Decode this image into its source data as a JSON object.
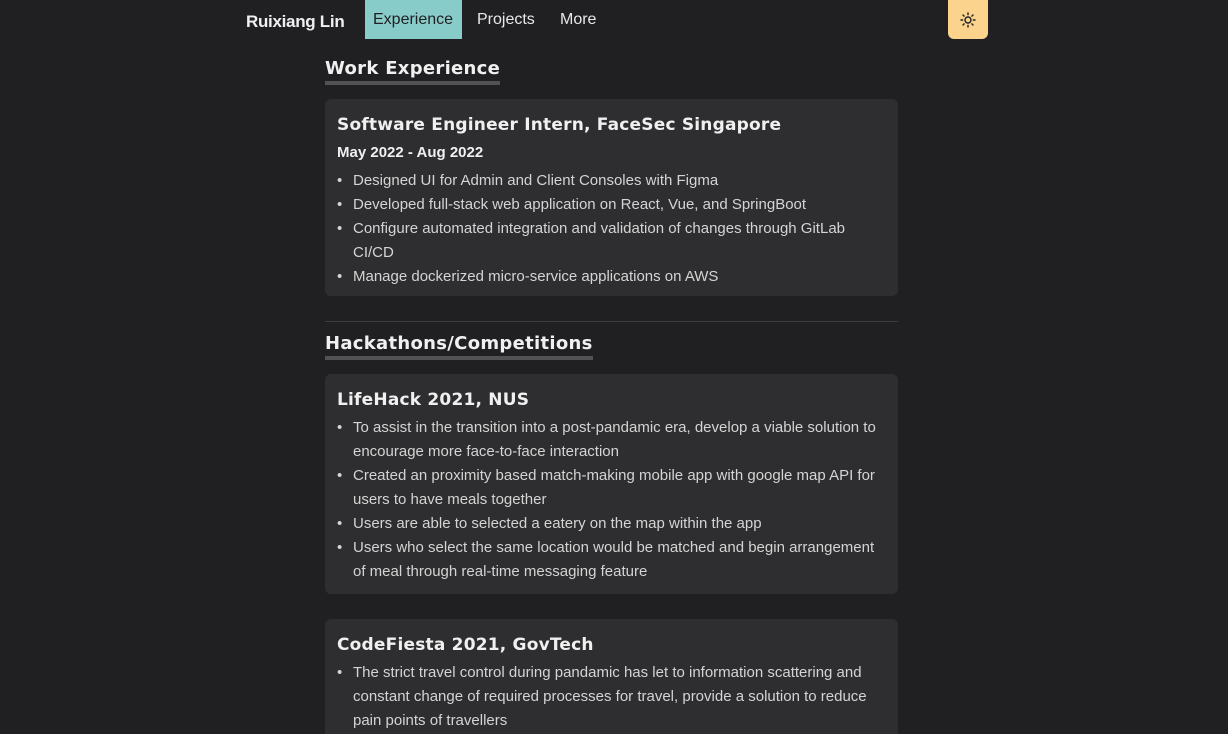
{
  "nav": {
    "logo": "Ruixiang Lin",
    "links": [
      "Experience",
      "Projects",
      "More"
    ],
    "theme_icon": "sun-icon",
    "accent_color": "#88ccca",
    "theme_button_color": "#fbd38d"
  },
  "work": {
    "title": "Work Experience",
    "jobs": [
      {
        "title": "Software Engineer Intern, FaceSec Singapore",
        "date": "May 2022 - Aug 2022",
        "bullets": [
          "Designed UI for Admin and Client Consoles with Figma",
          "Developed full-stack web application on React, Vue, and SpringBoot",
          "Configure automated integration and validation of changes through GitLab CI/CD",
          "Manage dockerized micro-service applications on AWS"
        ]
      }
    ]
  },
  "hackathons": {
    "title": "Hackathons/Competitions",
    "items": [
      {
        "title": "LifeHack 2021, NUS",
        "bullets": [
          "To assist in the transition into a post-pandamic era, develop a viable solution to encourage more face-to-face interaction",
          "Created an proximity based match-making mobile app with google map API for users to have meals together",
          "Users are able to selected a eatery on the map within the app",
          "Users who select the same location would be matched and begin arrangement of meal through real-time messaging feature"
        ]
      },
      {
        "title": "CodeFiesta 2021, GovTech",
        "bullets": [
          "The strict travel control during pandamic has let to information scattering and constant change of required processes for travel, provide a solution to reduce pain points of travellers"
        ]
      }
    ]
  }
}
